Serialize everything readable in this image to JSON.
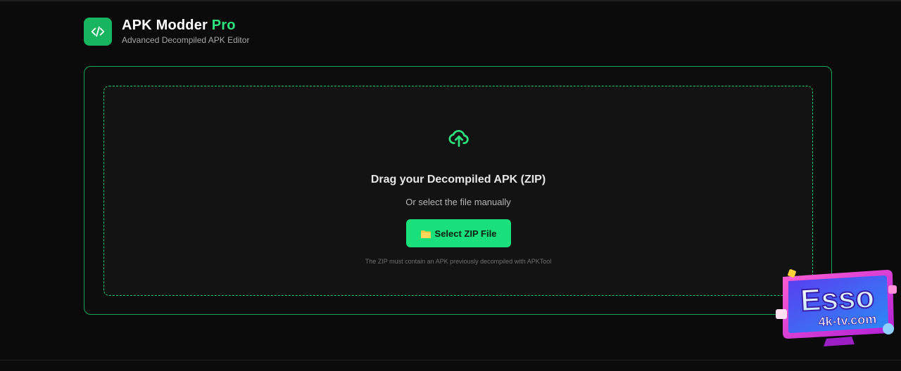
{
  "header": {
    "title_main": "APK Modder",
    "title_accent": "Pro",
    "subtitle": "Advanced Decompiled APK Editor",
    "logo_icon": "code-icon"
  },
  "dropzone": {
    "icon": "cloud-upload-icon",
    "title": "Drag your Decompiled APK (ZIP)",
    "subtitle": "Or select the file manually",
    "button_label": "Select ZIP File",
    "button_icon": "folder-icon",
    "note": "The ZIP must contain an APK previously decompiled with APKTool"
  },
  "watermark": {
    "line1": "Esso",
    "line2": "4k-tv.com"
  },
  "colors": {
    "accent": "#2ee37e",
    "button": "#19e07a",
    "logo_bg": "#17b55f",
    "background": "#0b0b0b"
  }
}
